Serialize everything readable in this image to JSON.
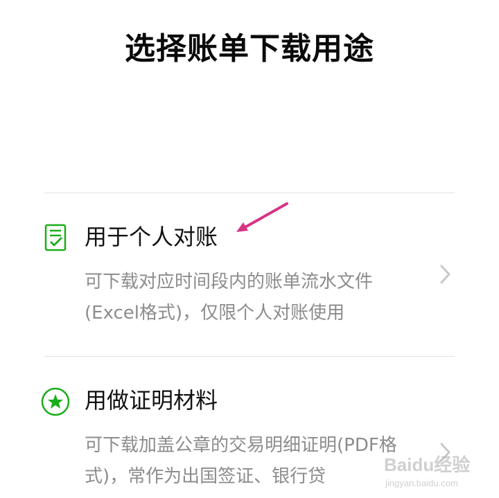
{
  "header": {
    "title": "选择账单下载用途"
  },
  "options": [
    {
      "title": "用于个人对账",
      "description": "可下载对应时间段内的账单流水文件(Excel格式)，仅限个人对账使用",
      "icon": "document-check-icon"
    },
    {
      "title": "用做证明材料",
      "description": "可下载加盖公章的交易明细证明(PDF格式)，常作为出国签证、银行贷",
      "icon": "star-circle-icon"
    }
  ],
  "icons": {
    "chevron": "chevron-right-icon",
    "annotation": "pointer-arrow"
  },
  "watermark": {
    "brand": "Baidu经验",
    "url": "jingyan.baidu.com"
  },
  "colors": {
    "accent_green": "#1AAD19",
    "annotation_pink": "#D63384",
    "secondary_text": "#8C8C8C",
    "chevron_gray": "#C8C8C8"
  }
}
